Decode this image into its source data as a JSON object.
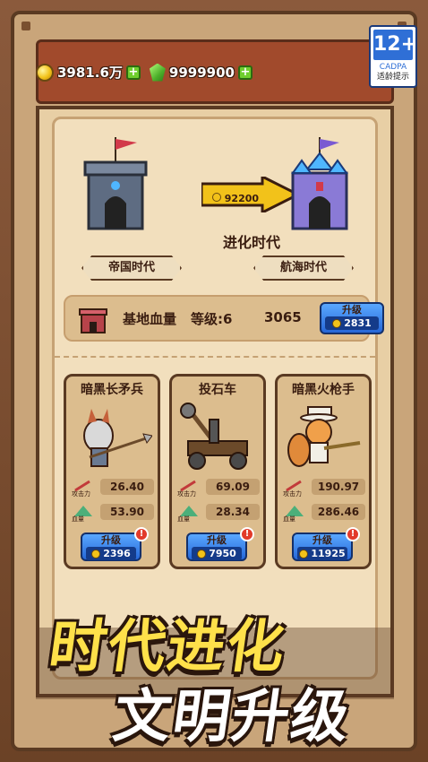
{
  "currency": {
    "gold": "3981.6万",
    "gems": "9999900",
    "add_symbol": "+"
  },
  "age_rating": {
    "rating": "12+",
    "org": "CADPA",
    "tip": "适龄提示"
  },
  "evolution": {
    "cost": "92200",
    "label": "进化时代",
    "current_era": "帝国时代",
    "next_era": "航海时代"
  },
  "base": {
    "label": "基地血量",
    "level": "等级:6",
    "hp": "3065",
    "upgrade_label": "升级",
    "upgrade_cost": "2831"
  },
  "units": [
    {
      "name": "暗黑长矛兵",
      "attack_label": "攻击力",
      "attack": "26.40",
      "hp_label": "血量",
      "hp": "53.90",
      "upgrade_label": "升级",
      "upgrade_cost": "2396",
      "alert": "!"
    },
    {
      "name": "投石车",
      "attack_label": "攻击力",
      "attack": "69.09",
      "hp_label": "血量",
      "hp": "28.34",
      "upgrade_label": "升级",
      "upgrade_cost": "7950",
      "alert": "!"
    },
    {
      "name": "暗黑火枪手",
      "attack_label": "攻击力",
      "attack": "190.97",
      "hp_label": "血量",
      "hp": "286.46",
      "upgrade_label": "升级",
      "upgrade_cost": "11925",
      "alert": "!"
    }
  ],
  "promo": {
    "line1": "时代进化",
    "line2": "文明升级"
  },
  "colors": {
    "accent_yellow": "#ffe14a",
    "button_blue": "#2667d8",
    "wood_dark": "#5a3a22",
    "alert_red": "#e23a2a"
  }
}
